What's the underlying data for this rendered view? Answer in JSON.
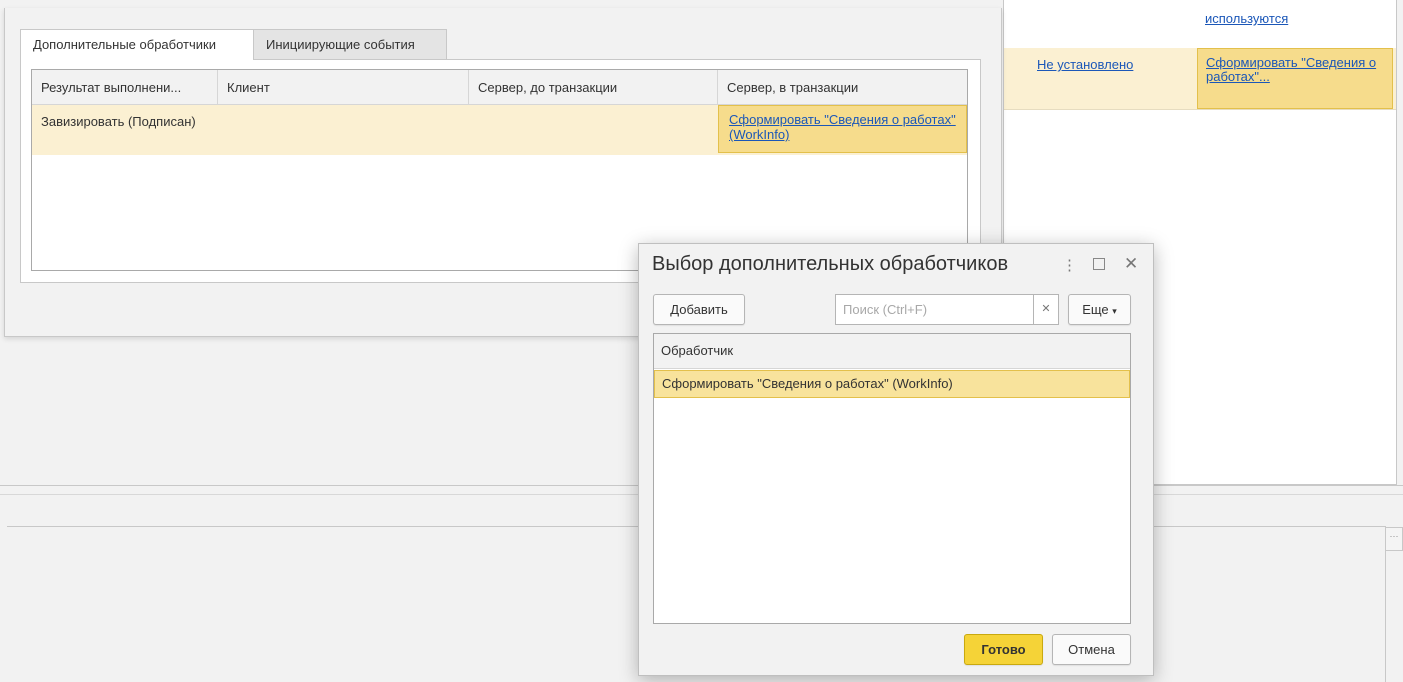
{
  "background_panel": {
    "top_link": "используются",
    "row_link_left": "Не установлено",
    "row_cell_link": "Сформировать \"Сведения о работах\"..."
  },
  "main": {
    "tabs": [
      {
        "label": "Дополнительные обработчики",
        "active": true
      },
      {
        "label": "Инициирующие события",
        "active": false
      }
    ],
    "columns": [
      "Результат выполнени...",
      "Клиент",
      "Сервер, до транзакции",
      "Сервер, в транзакции"
    ],
    "rows": [
      {
        "result": "Завизировать (Подписан)",
        "client": "",
        "server_before": "",
        "server_in": "Сформировать \"Сведения о работах\" (WorkInfo)"
      }
    ]
  },
  "dialog": {
    "title": "Выбор дополнительных обработчиков",
    "add_label": "Добавить",
    "search_placeholder": "Поиск (Ctrl+F)",
    "search_value": "",
    "more_label": "Еще",
    "column_header": "Обработчик",
    "items": [
      "Сформировать \"Сведения о работах\" (WorkInfo)"
    ],
    "ok_label": "Готово",
    "cancel_label": "Отмена",
    "icons": {
      "menu": "more-vertical-icon",
      "maximize": "maximize-icon",
      "close": "close-icon",
      "clear": "clear-icon",
      "dropdown": "chevron-down-icon"
    }
  },
  "colors": {
    "accent_yellow": "#f5d337",
    "selected_cell": "#f6dc8c",
    "row_highlight": "#fbf0d2",
    "link": "#1b57b8"
  }
}
